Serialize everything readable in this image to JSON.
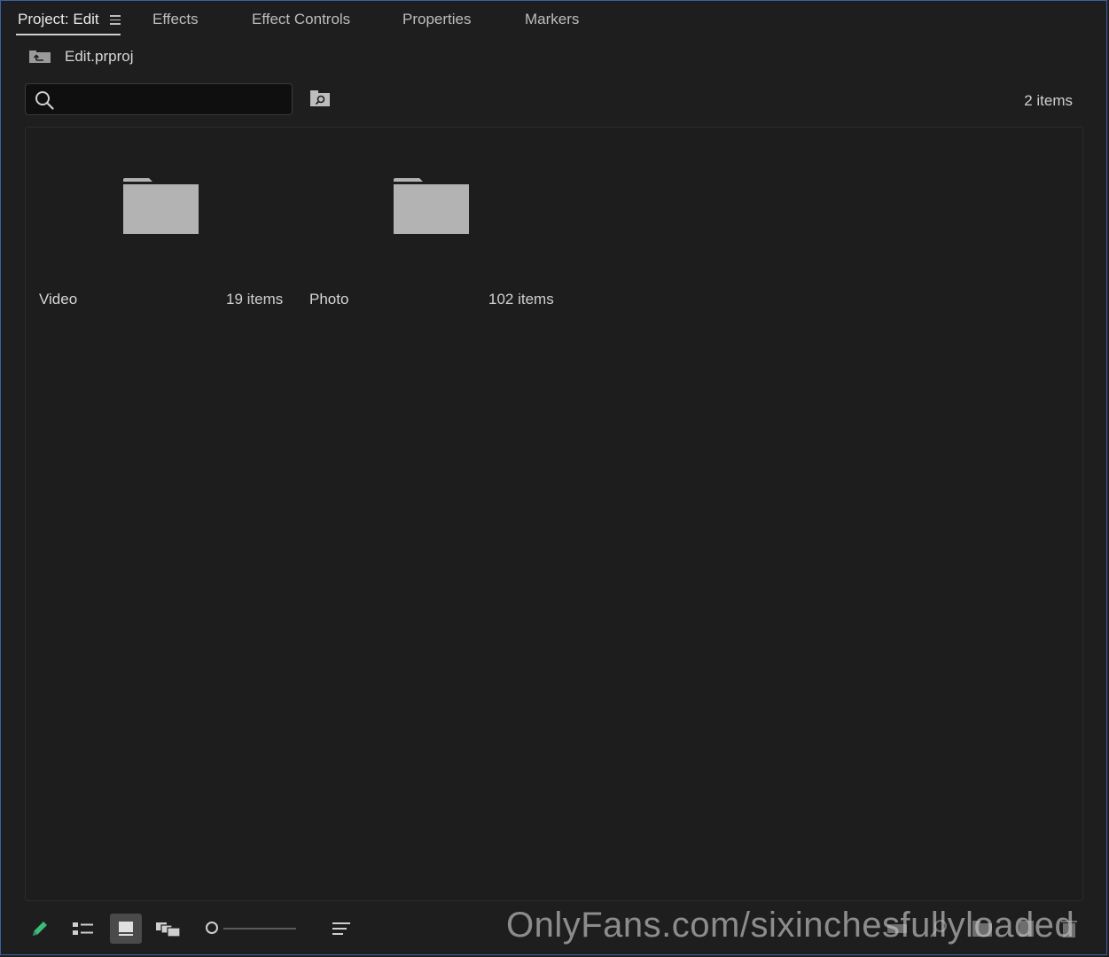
{
  "tabs": [
    {
      "label": "Project: Edit",
      "active": true
    },
    {
      "label": "Effects",
      "active": false
    },
    {
      "label": "Effect Controls",
      "active": false
    },
    {
      "label": "Properties",
      "active": false
    },
    {
      "label": "Markers",
      "active": false
    }
  ],
  "breadcrumb": {
    "project_name": "Edit.prproj",
    "icon": "project-up-icon"
  },
  "search": {
    "placeholder": "",
    "value": ""
  },
  "item_count": "2 items",
  "bins": [
    {
      "name": "Video",
      "count": "19 items",
      "icon": "folder-icon"
    },
    {
      "name": "Photo",
      "count": "102 items",
      "icon": "folder-icon"
    }
  ],
  "footer": {
    "tools": [
      "pencil-icon",
      "list-view-icon",
      "icon-view-icon",
      "freeform-view-icon",
      "zoom-slider",
      "sort-icon"
    ],
    "active_view": "icon-view-icon",
    "right_tools": [
      "automate-to-sequence-icon",
      "find-icon",
      "new-bin-icon",
      "new-item-icon",
      "clear-icon"
    ]
  },
  "watermark": "OnlyFans.com/sixinchesfullyloaded",
  "colors": {
    "background": "#1e1e1e",
    "accent_pencil": "#3dbb7a",
    "frame_border": "#3b5fa8",
    "folder": "#b3b3b3"
  }
}
